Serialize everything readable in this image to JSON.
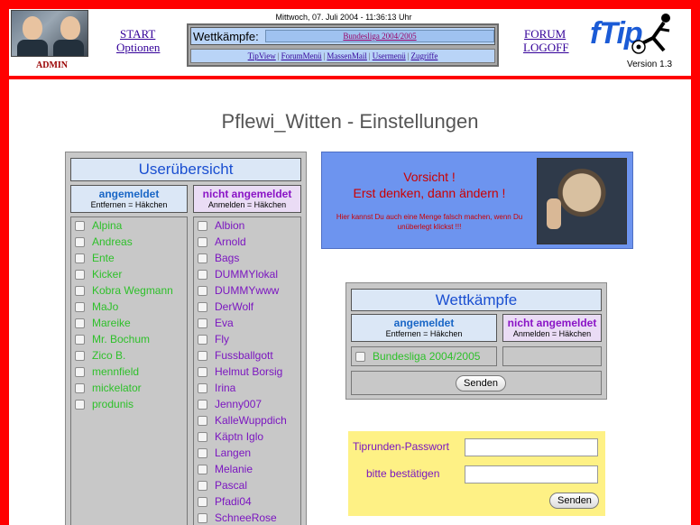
{
  "header": {
    "admin_label": "ADMIN",
    "links_left": {
      "start": "START",
      "options": "Optionen"
    },
    "links_right": {
      "forum": "FORUM",
      "logoff": "LOGOFF"
    },
    "datetime": "Mittwoch, 07. Juli 2004 - 11:36:13 Uhr",
    "competitions_label": "Wettkämpfe:",
    "competition_selected": "Bundesliga 2004/2005",
    "nav": [
      "TipView",
      "ForumMenü",
      "MassenMail",
      "Usermenü",
      "Zugriffe"
    ],
    "logo_text": "fTip",
    "version": "Version 1.3"
  },
  "page_title": "Pflewi_Witten - Einstellungen",
  "users": {
    "title": "Userübersicht",
    "registered": {
      "title": "angemeldet",
      "hint": "Entfernen = Häkchen"
    },
    "not_registered": {
      "title": "nicht angemeldet",
      "hint": "Anmelden = Häkchen"
    },
    "registered_list": [
      "Alpina",
      "Andreas",
      "Ente",
      "Kicker",
      "Kobra Wegmann",
      "MaJo",
      "Mareike",
      "Mr. Bochum",
      "Zico B.",
      "mennfield",
      "mickelator",
      "produnis"
    ],
    "not_registered_list": [
      "Albion",
      "Arnold",
      "Bags",
      "DUMMYlokal",
      "DUMMYwww",
      "DerWolf",
      "Eva",
      "Fly",
      "Fussballgott",
      "Helmut Borsig",
      "Irina",
      "Jenny007",
      "KalleWuppdich",
      "Käptn Iglo",
      "Langen",
      "Melanie",
      "Pascal",
      "Pfadi04",
      "SchneeRose"
    ]
  },
  "warning": {
    "line1": "Vorsicht !",
    "line2": "Erst denken, dann ändern !",
    "small": "Hier kannst Du auch eine Menge falsch machen, wenn Du unüberlegt klickst !!!"
  },
  "competitions": {
    "title": "Wettkämpfe",
    "registered": {
      "title": "angemeldet",
      "hint": "Entfernen = Häkchen"
    },
    "not_registered": {
      "title": "nicht angemeldet",
      "hint": "Anmelden = Häkchen"
    },
    "registered_list": [
      "Bundesliga 2004/2005"
    ],
    "submit": "Senden"
  },
  "password": {
    "label": "Tiprunden-Passwort",
    "confirm_label": "bitte bestätigen",
    "submit": "Senden"
  },
  "colors": {
    "frame": "#ff0000",
    "accent_blue": "#1a4fd1",
    "green": "#2ec02a",
    "purple": "#7b16c0",
    "warning_bg": "#6d94ef",
    "password_bg": "#fef185"
  }
}
